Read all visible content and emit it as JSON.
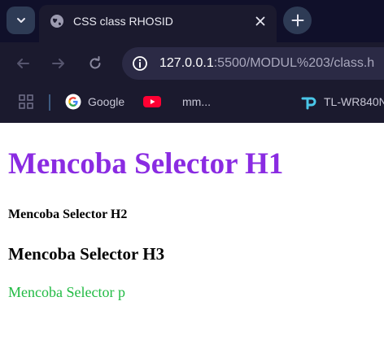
{
  "browser": {
    "tab": {
      "title": "CSS class RHOSID"
    },
    "address_bar": {
      "host": "127.0.0.1",
      "rest": ":5500/MODUL%203/class.h"
    },
    "bookmarks": [
      {
        "label": "Google",
        "icon": "google-icon"
      },
      {
        "label": "",
        "icon": "youtube-icon"
      },
      {
        "label": "mm...",
        "icon": ""
      },
      {
        "label": "TL-WR840N",
        "icon": "tplink-icon"
      }
    ]
  },
  "page": {
    "h1": "Mencoba Selector H1",
    "h2": "Mencoba Selector H2",
    "h3": "Mencoba Selector H3",
    "p": "Mencoba Selector p"
  },
  "colors": {
    "h1": "#8a2be2",
    "p": "#22bb44",
    "chrome_bg": "#1b1a2e",
    "tabstrip_bg": "#10102a"
  }
}
